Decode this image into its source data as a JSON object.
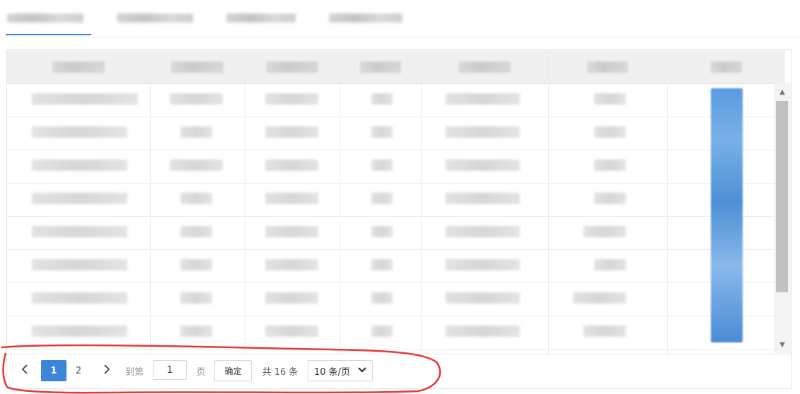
{
  "pagination": {
    "prev_icon": "chevron-left-icon",
    "next_icon": "chevron-right-icon",
    "pages": [
      "1",
      "2"
    ],
    "current_page": "1",
    "goto_label": "到第",
    "goto_value": "1",
    "page_unit": "页",
    "confirm_label": "确定",
    "total_label": "共 16 条",
    "page_size_label": "10 条/页",
    "page_size_icon": "chevron-down-icon"
  },
  "colors": {
    "accent": "#3b86d8",
    "annotation": "#e53935"
  }
}
